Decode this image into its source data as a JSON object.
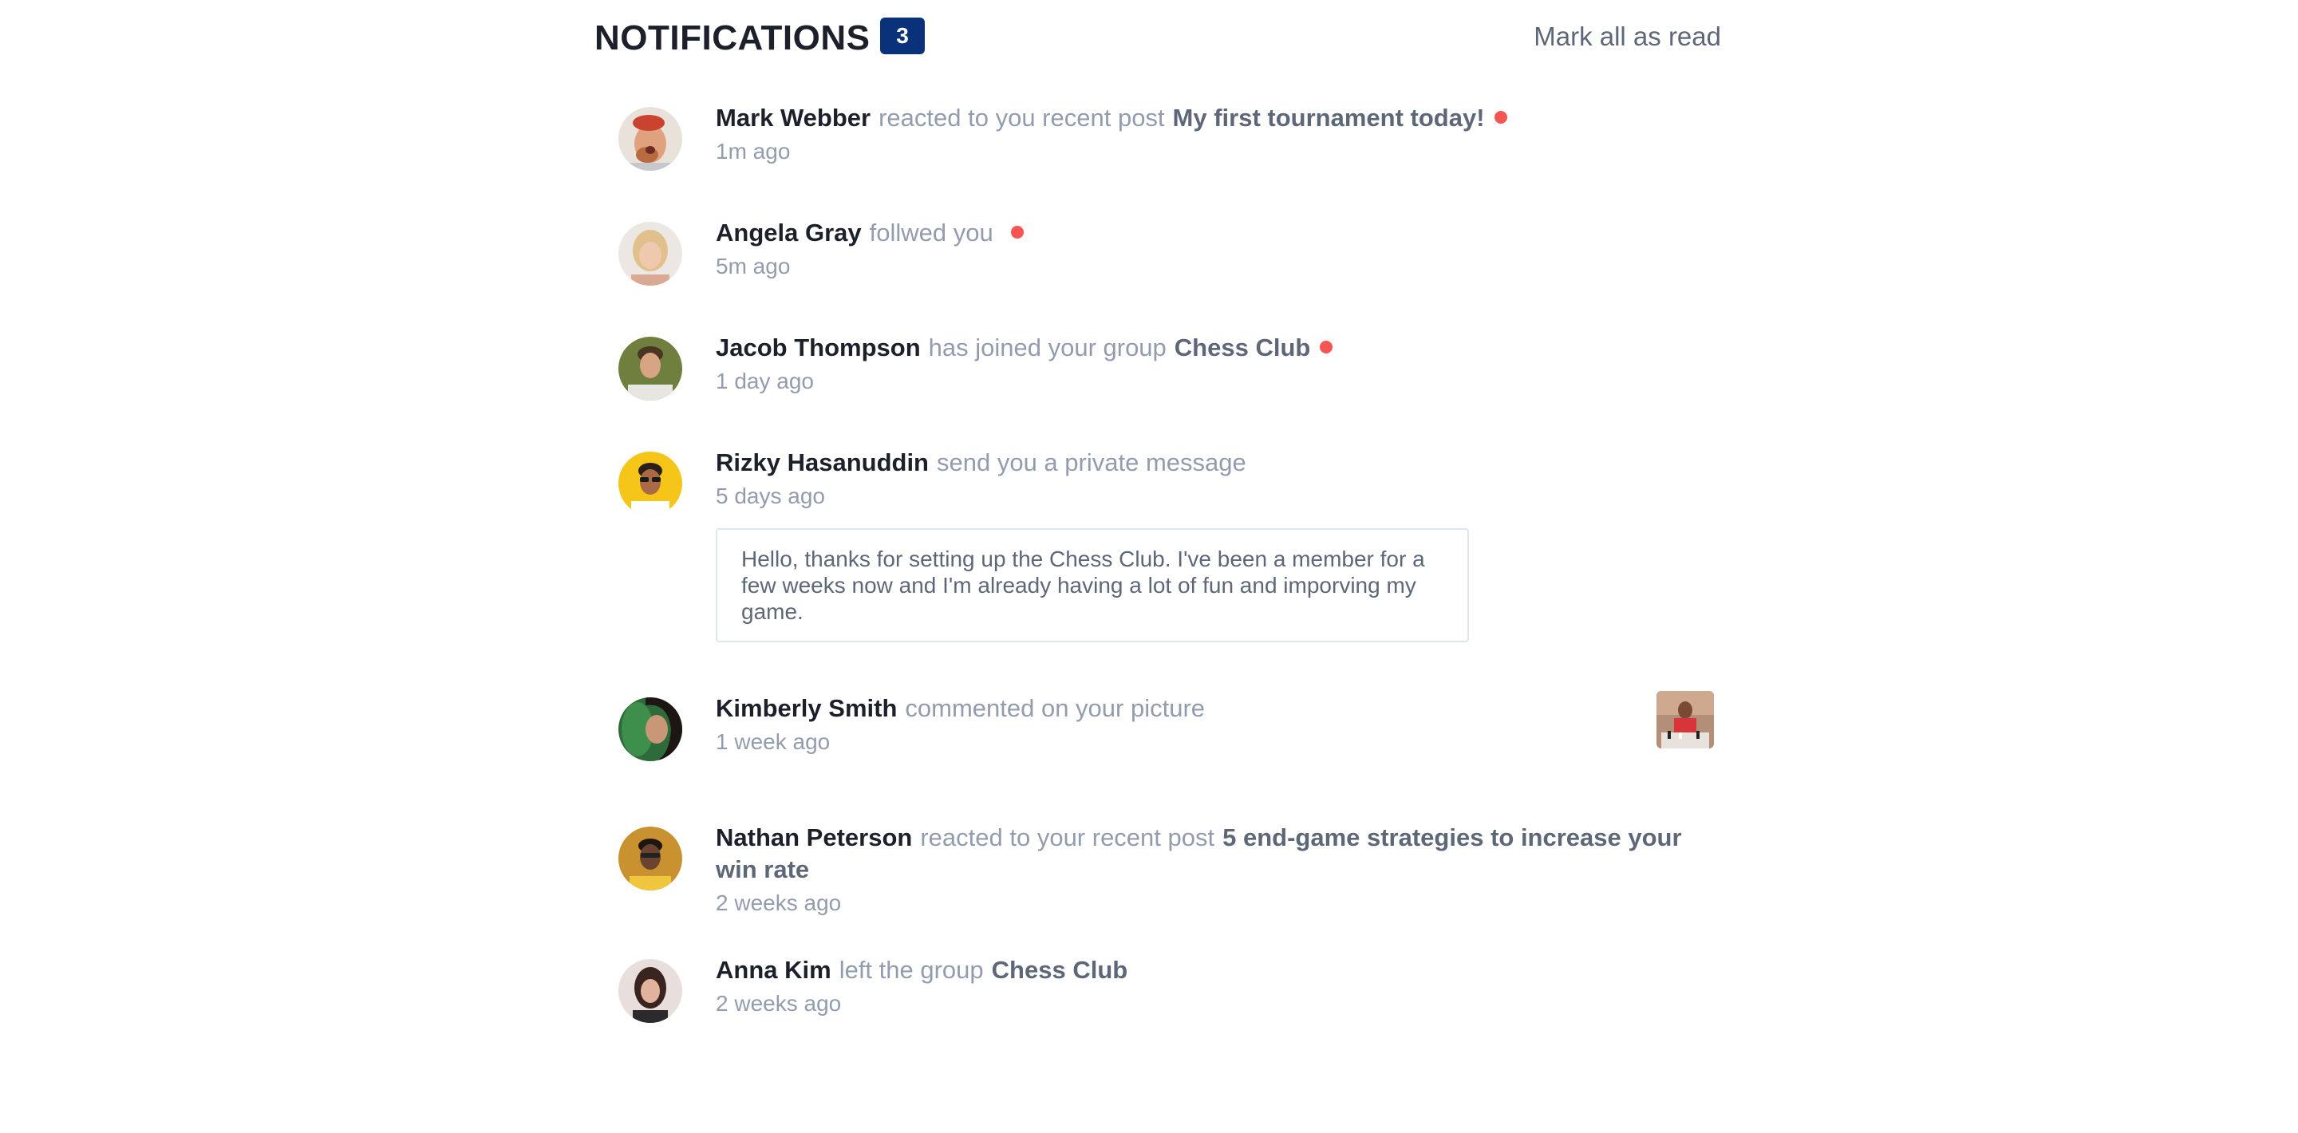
{
  "header": {
    "title": "NOTIFICATIONS",
    "count": "3",
    "mark_all": "Mark all as read"
  },
  "colors": {
    "badge": "#0a327b",
    "unread_dot": "#f65552",
    "dark_text": "#1c202b",
    "muted_text": "#939cad",
    "target_text": "#5e6778"
  },
  "notifications": [
    {
      "name": "Mark Webber",
      "action": "reacted to you recent post",
      "target": "My first tournament today!",
      "time": "1m ago",
      "unread": true
    },
    {
      "name": "Angela Gray",
      "action": "follwed you",
      "target": "",
      "time": "5m ago",
      "unread": true
    },
    {
      "name": "Jacob Thompson",
      "action": "has joined your group",
      "target": "Chess Club",
      "time": "1 day ago",
      "unread": true
    },
    {
      "name": "Rizky Hasanuddin",
      "action": "send you a private message",
      "target": "",
      "time": "5 days ago",
      "unread": false,
      "message": "Hello, thanks for setting up the Chess Club. I've been a member for a few weeks now and I'm already having a lot of fun and imporving my game."
    },
    {
      "name": "Kimberly Smith",
      "action": "commented on your picture",
      "target": "",
      "time": "1 week ago",
      "unread": false,
      "picture_icon": "chess-picture-thumbnail"
    },
    {
      "name": "Nathan Peterson",
      "action": "reacted to your recent post",
      "target": "5 end-game strategies to increase your win rate",
      "time": "2 weeks ago",
      "unread": false
    },
    {
      "name": "Anna Kim",
      "action": "left the group",
      "target": "Chess Club",
      "time": "2 weeks ago",
      "unread": false
    }
  ]
}
